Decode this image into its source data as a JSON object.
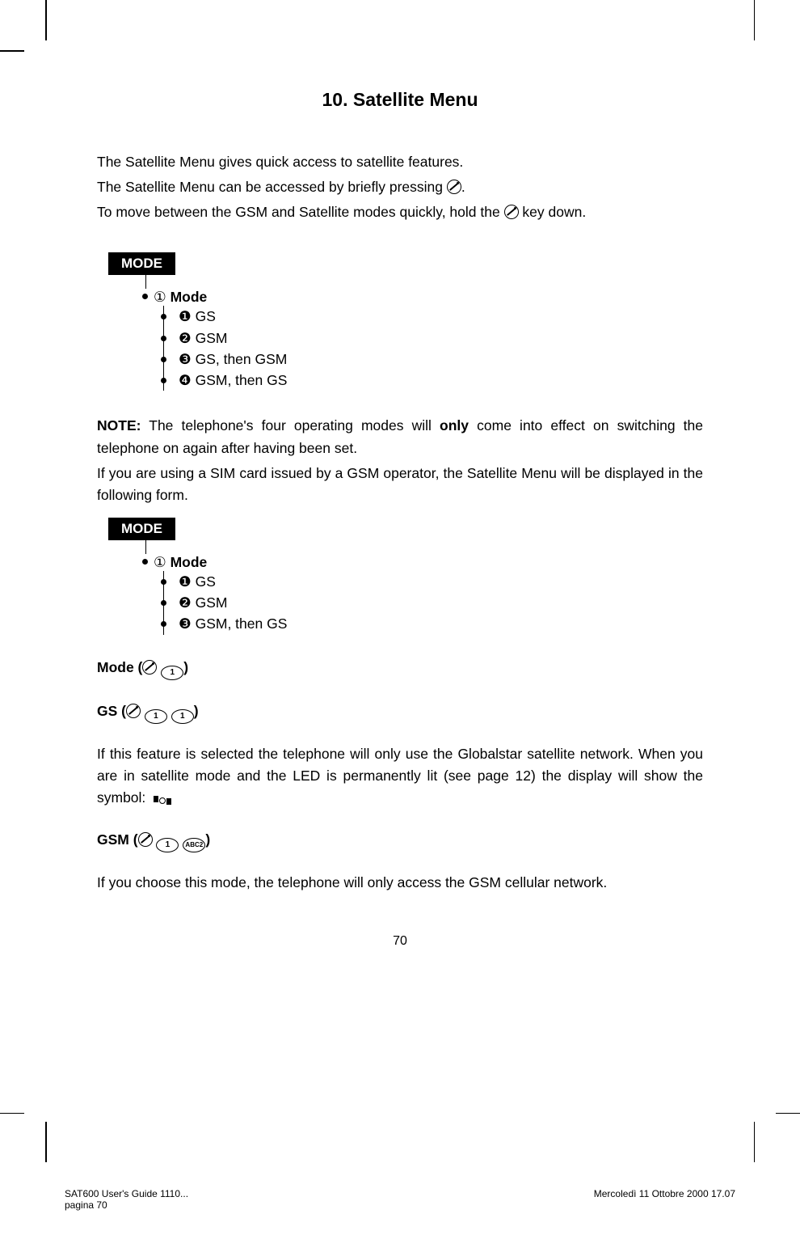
{
  "title": "10. Satellite Menu",
  "intro": {
    "line1": "The Satellite Menu gives quick access to satellite features.",
    "line2a": "The Satellite Menu can be accessed by briefly pressing ",
    "line2b": ".",
    "line3a": "To move between the GSM and Satellite modes quickly, hold the ",
    "line3b": " key down."
  },
  "mode_label": "MODE",
  "tree1": {
    "l1_num": "①",
    "l1_label": "Mode",
    "items": [
      {
        "num": "❶",
        "label": "GS"
      },
      {
        "num": "❷",
        "label": "GSM"
      },
      {
        "num": "❸",
        "label": "GS, then GSM"
      },
      {
        "num": "❹",
        "label": "GSM, then GS"
      }
    ]
  },
  "note": {
    "prefix": "NOTE:",
    "text1a": " The telephone's four operating modes will ",
    "bold": "only",
    "text1b": " come into effect on switching the telephone on again after having been set.",
    "text2": "If you are using a SIM card issued by a GSM operator, the Satellite Menu will be displayed in the following form."
  },
  "tree2": {
    "l1_num": "①",
    "l1_label": "Mode",
    "items": [
      {
        "num": "❶",
        "label": "GS"
      },
      {
        "num": "❷",
        "label": "GSM"
      },
      {
        "num": "❸",
        "label": "GSM, then GS"
      }
    ]
  },
  "sections": {
    "mode": {
      "label": "Mode (",
      "key1": "1",
      "end": ")"
    },
    "gs": {
      "label": "GS (",
      "key1": "1",
      "key2": "1",
      "end": ")"
    },
    "gs_text1": "If this feature is selected the telephone will only use the Globalstar satellite network. When you are in satellite mode and the LED is permanently lit (see page 12) the display will show the symbol:",
    "gsm": {
      "label": "GSM (",
      "key1": "1",
      "key2": "ABC2",
      "end": ")"
    },
    "gsm_text": "If you choose this mode, the telephone will only access the GSM cellular network."
  },
  "page_num": "70",
  "footer": {
    "left_line1": "SAT600 User's Guide 1110...",
    "left_line2": "pagina 70",
    "right": "Mercoledì 11 Ottobre 2000 17.07"
  }
}
